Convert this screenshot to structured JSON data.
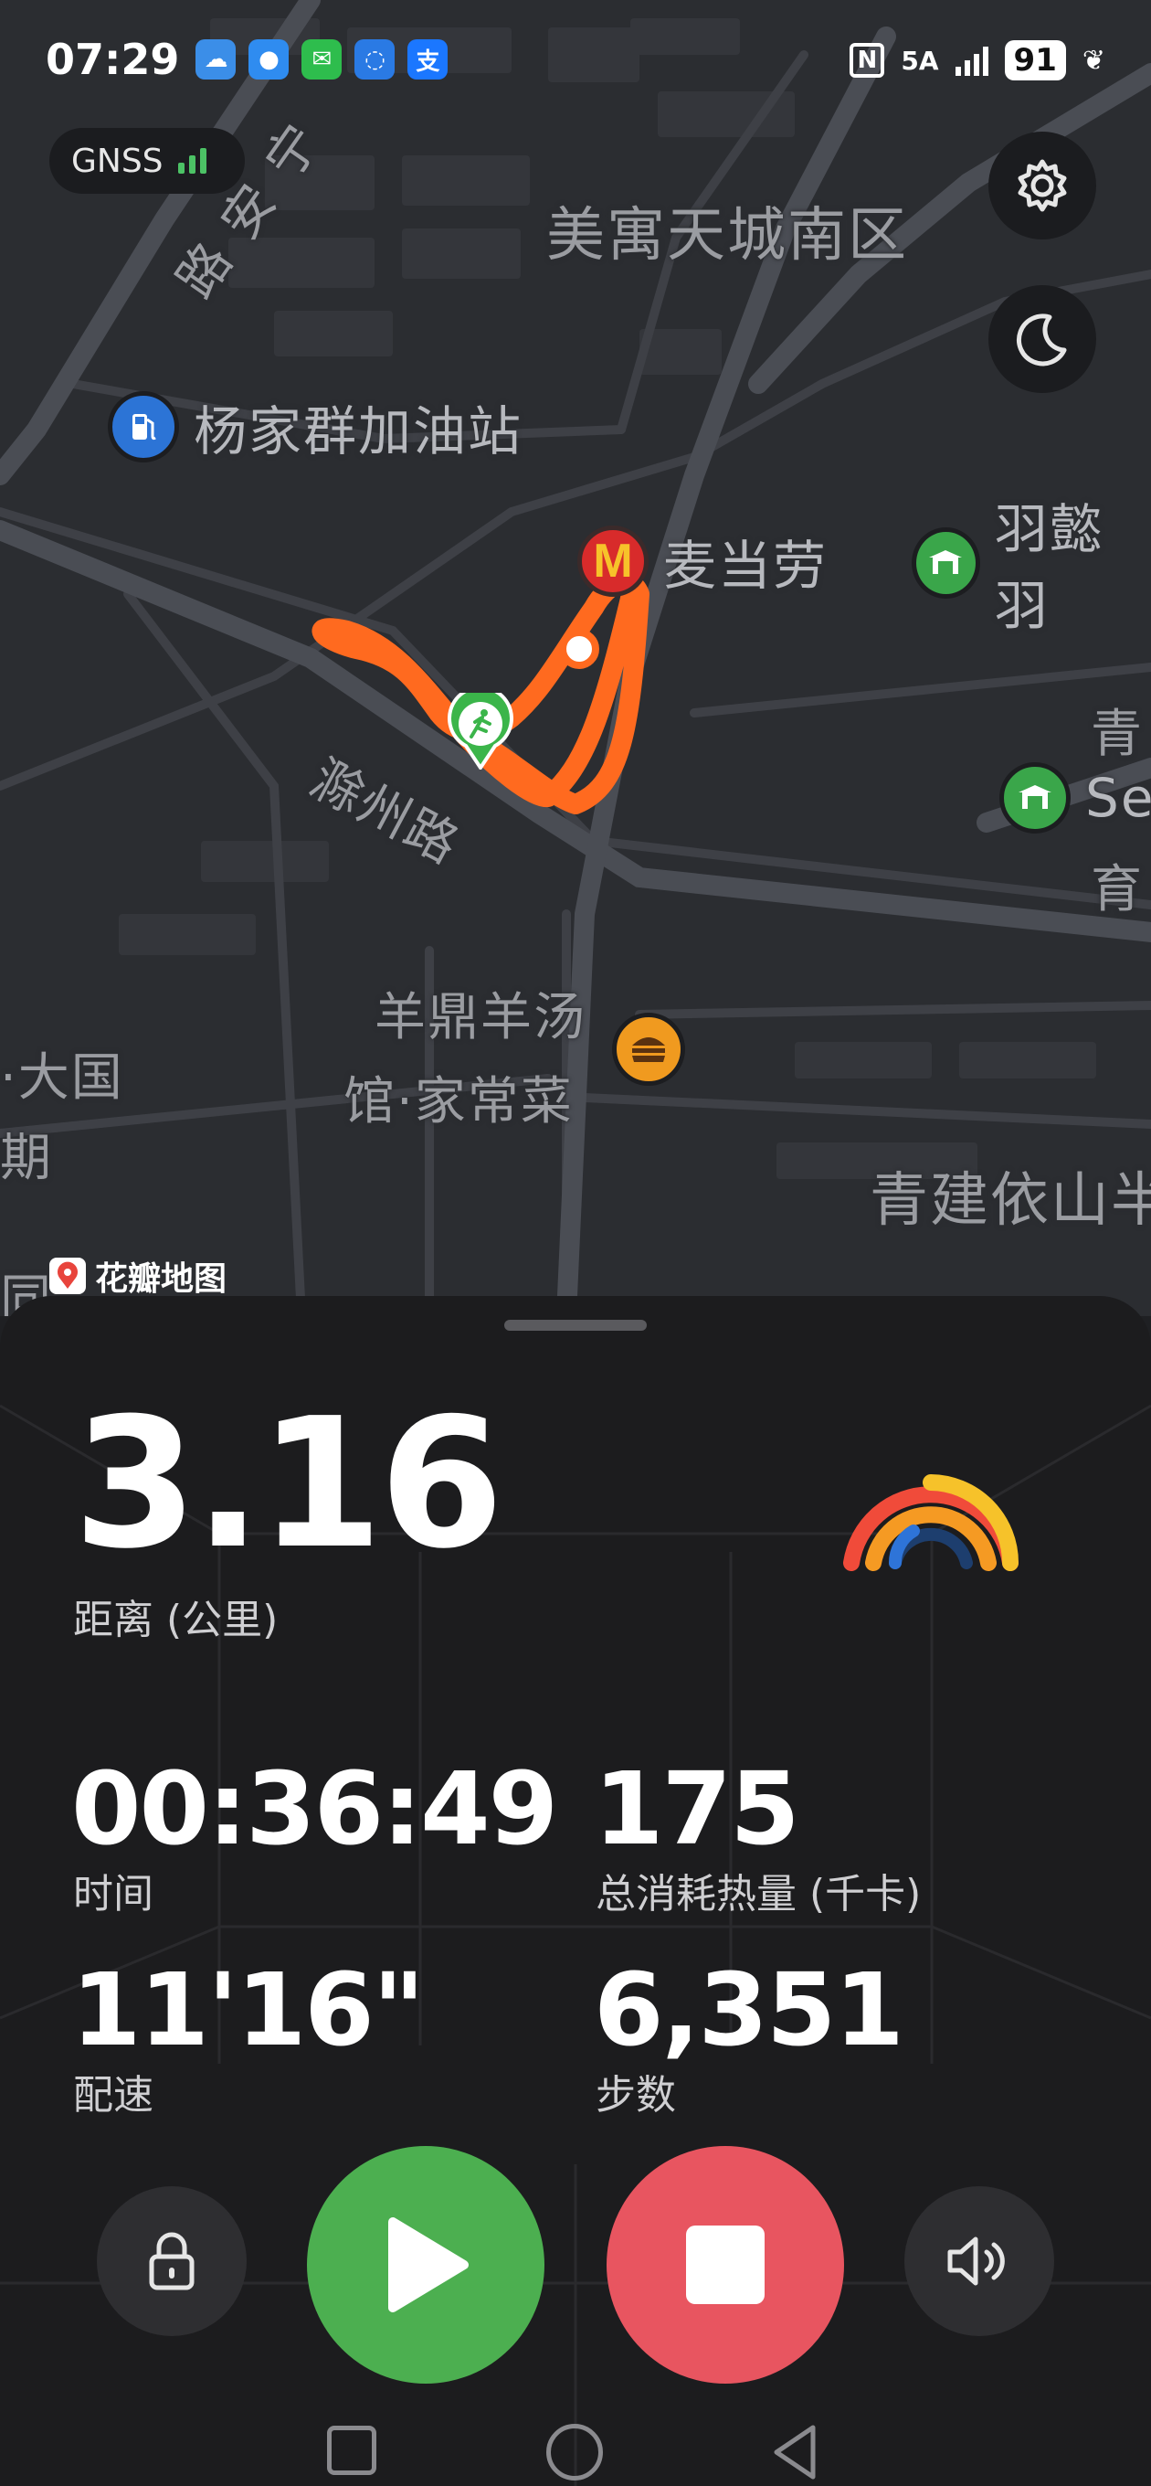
{
  "status_bar": {
    "time": "07:29",
    "network": "5A",
    "battery": "91",
    "app_icons": [
      "weather-icon",
      "messages-icon",
      "wechat-icon",
      "bulb-icon",
      "alipay-icon"
    ]
  },
  "gnss": {
    "label": "GNSS"
  },
  "map": {
    "labels": {
      "road_ning": "宁",
      "road_an": "安",
      "road_lu": "路",
      "meiyu": "美寓天城南区",
      "chuzhou_road": "滁州路",
      "daguo": "·大国",
      "qi": "期",
      "tong": "同",
      "qing": "青",
      "yu": "育",
      "qingjian": "青建依山半"
    },
    "pois": {
      "gas_station": "杨家群加油站",
      "mcdonalds": "麦当劳",
      "yuyi": "羽懿羽",
      "se": "Se",
      "yangding_1": "羊鼎羊汤",
      "yangding_2": "馆·家常菜"
    },
    "attribution": "花瓣地图"
  },
  "workout": {
    "distance_value": "3.16",
    "distance_label": "距离 (公里)",
    "time_value": "00:36:49",
    "time_label": "时间",
    "calories_value": "175",
    "calories_label": "总消耗热量 (千卡)",
    "pace_value": "11'16\"",
    "pace_label": "配速",
    "steps_value": "6,351",
    "steps_label": "步数"
  },
  "colors": {
    "route": "#ff6a1f",
    "start_pin": "#3bb54a",
    "play": "#4caf50",
    "stop": "#e85560",
    "ring_red": "#f04b3a",
    "ring_orange": "#f59a23",
    "ring_yellow": "#f6c22a",
    "ring_blue": "#2e74d8"
  }
}
